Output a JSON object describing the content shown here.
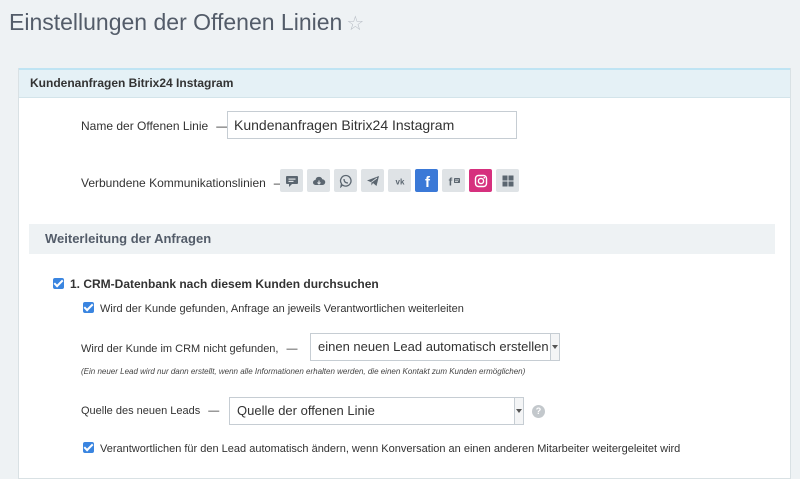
{
  "page": {
    "title": "Einstellungen der Offenen Linien",
    "star_icon": "☆"
  },
  "panel": {
    "header": "Kundenanfragen Bitrix24 Instagram",
    "name_label": "Name der Offenen Linie",
    "name_dash": "—",
    "name_value": "Kundenanfragen Bitrix24 Instagram",
    "channels_label": "Verbundene Kommunikationslinien",
    "channels_dash": "—",
    "channels": [
      {
        "name": "livechat-icon",
        "active": false
      },
      {
        "name": "cloud-icon",
        "active": false
      },
      {
        "name": "viber-icon",
        "active": false
      },
      {
        "name": "telegram-icon",
        "active": false
      },
      {
        "name": "vk-icon",
        "active": false
      },
      {
        "name": "facebook-icon",
        "active": true,
        "color": "#3b79d7"
      },
      {
        "name": "facebook-comments-icon",
        "active": false
      },
      {
        "name": "instagram-icon",
        "active": true,
        "color": "#d6307e"
      },
      {
        "name": "more-channels-icon",
        "active": false
      }
    ]
  },
  "routing": {
    "section_title": "Weiterleitung der Anfragen",
    "crm_search_label": "1. CRM-Datenbank nach diesem Kunden durchsuchen",
    "crm_search_checked": true,
    "found_forward_label": "Wird der Kunde gefunden, Anfrage an jeweils Verantwortlichen weiterleiten",
    "found_forward_checked": true,
    "not_found_label": "Wird der Kunde im CRM nicht gefunden,",
    "not_found_dash": "—",
    "not_found_select": "einen neuen Lead automatisch erstellen",
    "not_found_note": "(Ein neuer Lead wird nur dann erstellt, wenn alle Informationen erhalten werden, die einen Kontakt zum Kunden ermöglichen)",
    "source_label": "Quelle des neuen Leads",
    "source_dash": "—",
    "source_select": "Quelle der offenen Linie",
    "help_icon": "?",
    "auto_change_label": "Verantwortlichen für den Lead automatisch ändern, wenn Konversation an einen anderen Mitarbeiter weitergeleitet wird",
    "auto_change_checked": true
  }
}
